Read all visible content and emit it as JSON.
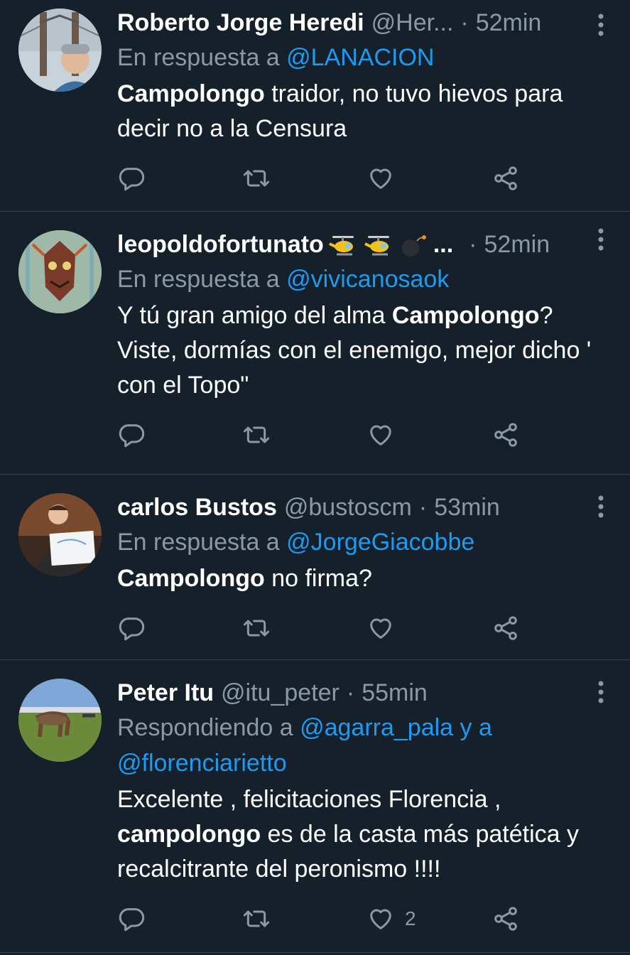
{
  "tweets": [
    {
      "display_name": "Roberto Jorge Heredi",
      "handle": "@Her...",
      "dot": "·",
      "time": "52min",
      "reply_prefix": "En respuesta a ",
      "reply_mentions": "@LANACION",
      "body_bold": "Campolongo",
      "body_rest": " traidor, no tuvo hievos para decir no a la Censura",
      "like_count": ""
    },
    {
      "display_name": "leopoldofortunato",
      "display_name_suffix": "...",
      "emojis": [
        "helicopter-emoji",
        "helicopter-emoji",
        "bomb-emoji"
      ],
      "dot": "·",
      "time": "52min",
      "reply_prefix": "En respuesta a ",
      "reply_mentions": "@vivicanosaok",
      "body_pre": "Y tú gran amigo del alma ",
      "body_bold": "Campolongo",
      "body_rest": "? Viste, dormías con el enemigo, mejor dicho ' con el Topo\"",
      "like_count": ""
    },
    {
      "display_name": "carlos Bustos",
      "handle": "@bustoscm",
      "dot": "·",
      "time": "53min",
      "reply_prefix": "En respuesta a ",
      "reply_mentions": "@JorgeGiacobbe",
      "body_bold": "Campolongo",
      "body_rest": " no firma?",
      "like_count": ""
    },
    {
      "display_name": "Peter Itu",
      "handle": "@itu_peter",
      "dot": "·",
      "time": "55min",
      "reply_prefix": "Respondiendo a ",
      "reply_mentions": "@agarra_pala y a @florenciarietto",
      "body_pre": "Excelente , felicitaciones Florencia , ",
      "body_bold": "campolongo",
      "body_rest": " es de la casta más patética y recalcitrante del peronismo !!!!",
      "like_count": "2"
    }
  ],
  "colors": {
    "background": "#15202b",
    "secondary_text": "#8b98a5",
    "accent": "#1d9bf0",
    "divider": "#38444d"
  }
}
